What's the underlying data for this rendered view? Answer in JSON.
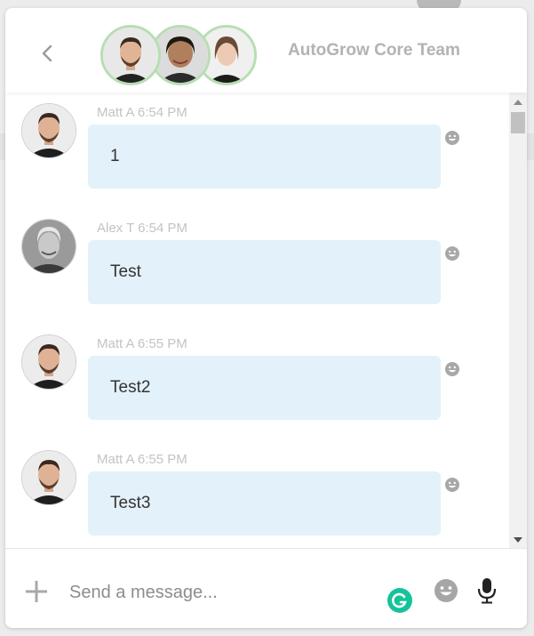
{
  "header": {
    "back_icon": "chevron-left-icon",
    "team_name": "AutoGrow Core Team",
    "members": [
      "Matt A",
      "Alex T",
      "member-3"
    ]
  },
  "messages": [
    {
      "sender": "Matt A",
      "time": "6:54 PM",
      "meta": "Matt A 6:54 PM",
      "text": "1",
      "avatar": "matt-a-avatar"
    },
    {
      "sender": "Alex T",
      "time": "6:54 PM",
      "meta": "Alex T 6:54 PM",
      "text": "Test",
      "avatar": "alex-t-avatar"
    },
    {
      "sender": "Matt A",
      "time": "6:55 PM",
      "meta": "Matt A 6:55 PM",
      "text": "Test2",
      "avatar": "matt-a-avatar"
    },
    {
      "sender": "Matt A",
      "time": "6:55 PM",
      "meta": "Matt A 6:55 PM",
      "text": "Test3",
      "avatar": "matt-a-avatar"
    }
  ],
  "composer": {
    "placeholder": "Send a message...",
    "value": "",
    "icons": [
      "plus-icon",
      "grammarly-icon",
      "emoji-icon",
      "microphone-icon"
    ]
  },
  "colors": {
    "bubble": "#e3f1fa",
    "avatar_ring": "#b7deb3",
    "grammarly": "#15c39a",
    "header_text": "#b3b3b3"
  }
}
